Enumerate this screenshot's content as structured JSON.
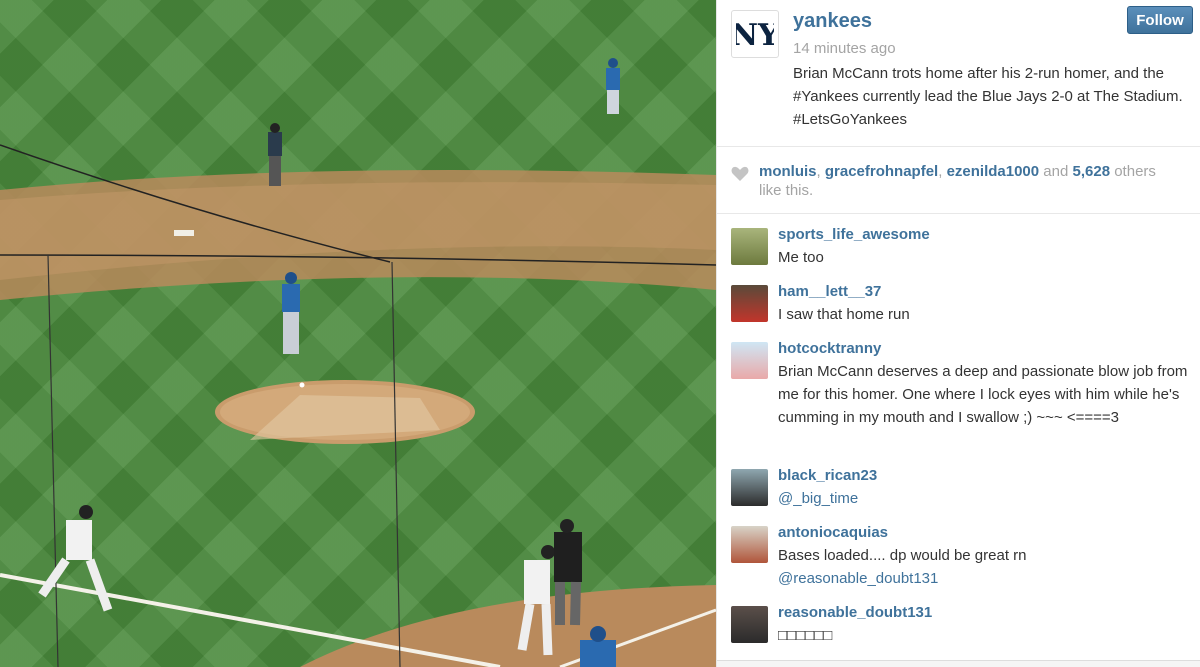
{
  "post": {
    "username": "yankees",
    "time": "14 minutes ago",
    "caption": "Brian McCann trots home after his 2-run homer, and the #Yankees currently lead the Blue Jays 2-0 at The Stadium. #LetsGoYankees",
    "follow_label": "Follow",
    "logo_icon": "ny-logo-icon"
  },
  "likes": {
    "users": [
      "monluis",
      "gracefrohnapfel",
      "ezenilda1000"
    ],
    "and_label": "and",
    "count": "5,628",
    "suffix": "others like this."
  },
  "comments": [
    {
      "user": "sports_life_awesome",
      "text": "Me too"
    },
    {
      "user": "ham__lett__37",
      "text": "I saw that home run"
    },
    {
      "user": "hotcocktranny",
      "text": "Brian McCann deserves a deep and passionate blow job from me for this homer. One where I lock eyes with him while he's cumming in my mouth and I swallow ;) ~~~ <====3"
    },
    {
      "user": "black_rican23",
      "text": "@_big_time"
    },
    {
      "user": "antoniocaquias",
      "text": "Bases loaded.... dp would be great rn",
      "mention": "@reasonable_doubt131"
    },
    {
      "user": "reasonable_doubt131",
      "text": "□□□□□□"
    }
  ],
  "colors": {
    "link": "#3f729b",
    "muted": "#a4a4a4",
    "text": "#333333"
  }
}
